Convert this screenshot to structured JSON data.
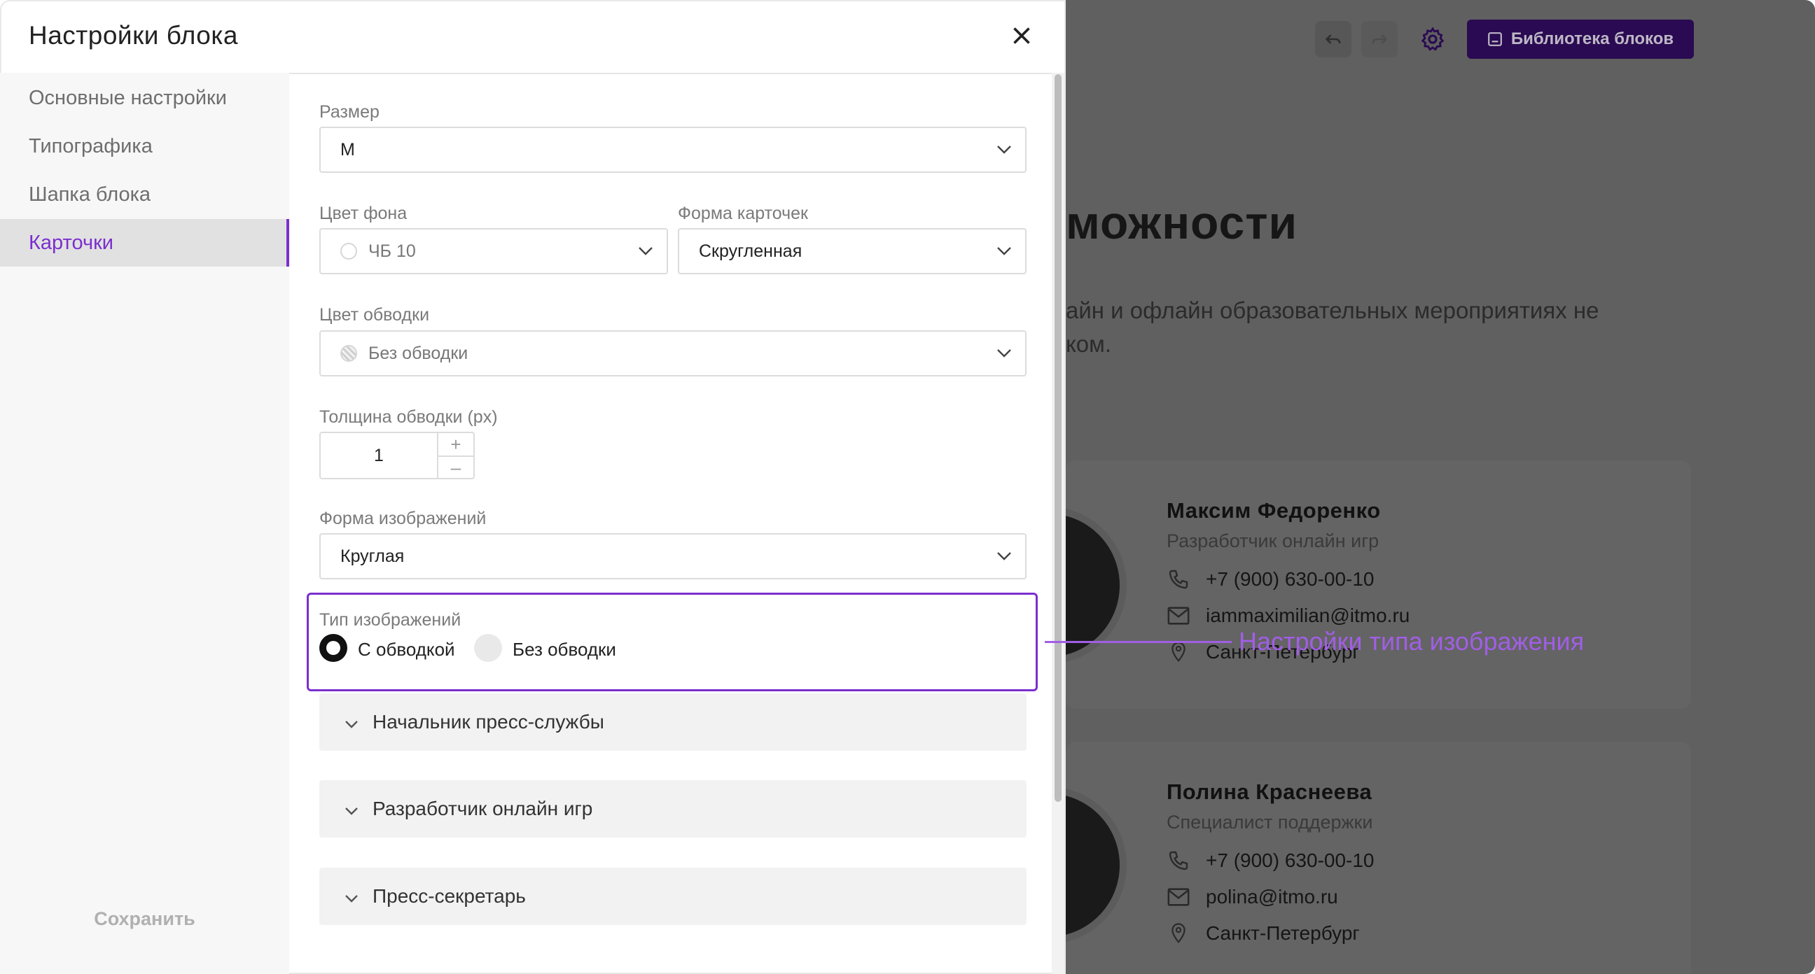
{
  "modal": {
    "title": "Настройки блока",
    "close_icon": "close-icon",
    "sidebar": {
      "items": [
        {
          "label": "Основные настройки",
          "active": false
        },
        {
          "label": "Типографика",
          "active": false
        },
        {
          "label": "Шапка блока",
          "active": false
        },
        {
          "label": "Карточки",
          "active": true
        }
      ],
      "save_label": "Сохранить"
    },
    "form": {
      "size": {
        "label": "Размер",
        "value": "M"
      },
      "bg_color": {
        "label": "Цвет фона",
        "value": "ЧБ 10"
      },
      "card_shape": {
        "label": "Форма карточек",
        "value": "Скругленная"
      },
      "stroke_color": {
        "label": "Цвет обводки",
        "value": "Без обводки"
      },
      "stroke_width": {
        "label": "Толщина обводки (px)",
        "value": "1",
        "plus": "+",
        "minus": "–"
      },
      "image_shape": {
        "label": "Форма изображений",
        "value": "Круглая"
      },
      "image_type": {
        "label": "Тип изображений",
        "options": [
          {
            "label": "С обводкой",
            "selected": true
          },
          {
            "label": "Без обводки",
            "selected": false
          }
        ]
      }
    },
    "accordions": [
      {
        "label": "Начальник пресс-службы"
      },
      {
        "label": "Разработчик онлайн игр"
      },
      {
        "label": "Пресс-секретарь"
      }
    ]
  },
  "annotation": {
    "label": "Настройки типа изображения",
    "color": "#a15ee6"
  },
  "background_page": {
    "toolbar": {
      "undo_icon": "undo-icon",
      "redo_icon": "redo-icon",
      "gear_icon": "gear-icon",
      "library_label": "Библиотека блоков"
    },
    "heading": "можности",
    "description_lines": [
      "айн и офлайн образовательных мероприятиях не",
      "ком."
    ],
    "cards": [
      {
        "name": "Максим Федоренко",
        "role": "Разработчик онлайн игр",
        "phone": "+7 (900) 630-00-10",
        "email": "iammaximilian@itmo.ru",
        "city": "Санкт-Петербург"
      },
      {
        "name": "Полина Краснеева",
        "role": "Специалист поддержки",
        "phone": "+7 (900) 630-00-10",
        "email": "polina@itmo.ru",
        "city": "Санкт-Петербург"
      }
    ]
  },
  "colors": {
    "accent": "#7b2fcf",
    "library_button": "#2a0a52",
    "overlay": "#606060"
  }
}
